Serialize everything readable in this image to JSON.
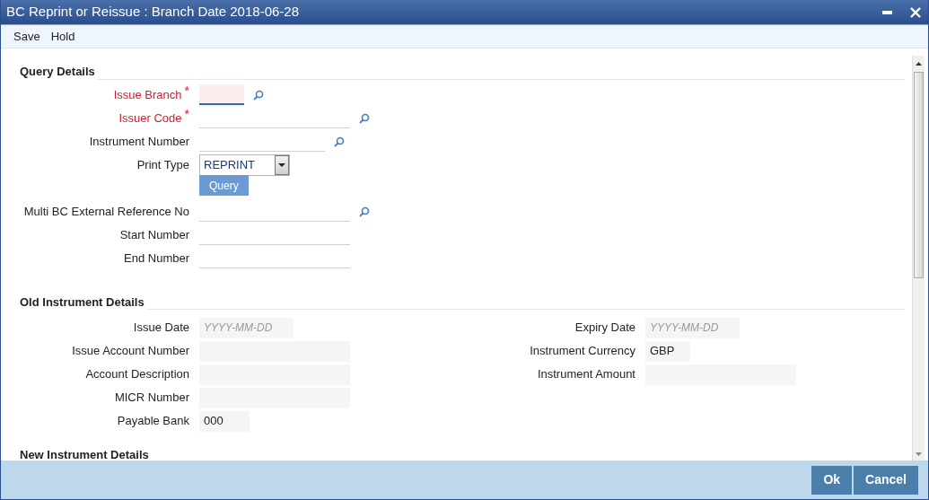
{
  "window": {
    "title": "BC Reprint or Reissue : Branch Date 2018-06-28"
  },
  "toolbar": [
    "Save",
    "Hold"
  ],
  "query_details": {
    "heading": "Query Details",
    "fields": [
      {
        "kind": "underline",
        "label": "Issue Branch",
        "required_mark": "*",
        "focused": true,
        "lookup": true
      },
      {
        "kind": "underline",
        "label": "Issuer Code",
        "required_mark": "*",
        "focused": false,
        "lookup": true
      },
      {
        "kind": "underline",
        "label": "Instrument Number",
        "focused": false,
        "lookup": true
      },
      {
        "kind": "select",
        "label": "Print Type",
        "value": "REPRINT"
      },
      {
        "kind": "button",
        "label": "Query"
      },
      {
        "kind": "underline",
        "label": "Multi BC External Reference No",
        "focused": false,
        "lookup": true
      },
      {
        "kind": "underline",
        "label": "Start Number",
        "focused": false,
        "lookup": false
      },
      {
        "kind": "underline",
        "label": "End Number",
        "focused": false,
        "lookup": false
      }
    ]
  },
  "old_instrument_details": {
    "heading": "Old Instrument Details",
    "left": [
      {
        "label": "Issue Date",
        "placeholder": "YYYY-MM-DD"
      },
      {
        "label": "Issue Account Number"
      },
      {
        "label": "Account Description"
      },
      {
        "label": "MICR Number"
      },
      {
        "label": "Payable Bank",
        "value": "000"
      }
    ],
    "right": [
      {
        "label": "Expiry Date",
        "placeholder": "YYYY-MM-DD"
      },
      {
        "label": "Instrument Currency",
        "value": "GBP"
      },
      {
        "label": "Instrument Amount"
      }
    ]
  },
  "new_instrument_details": {
    "heading": "New Instrument Details"
  },
  "footer_buttons": [
    "Ok",
    "Cancel"
  ]
}
